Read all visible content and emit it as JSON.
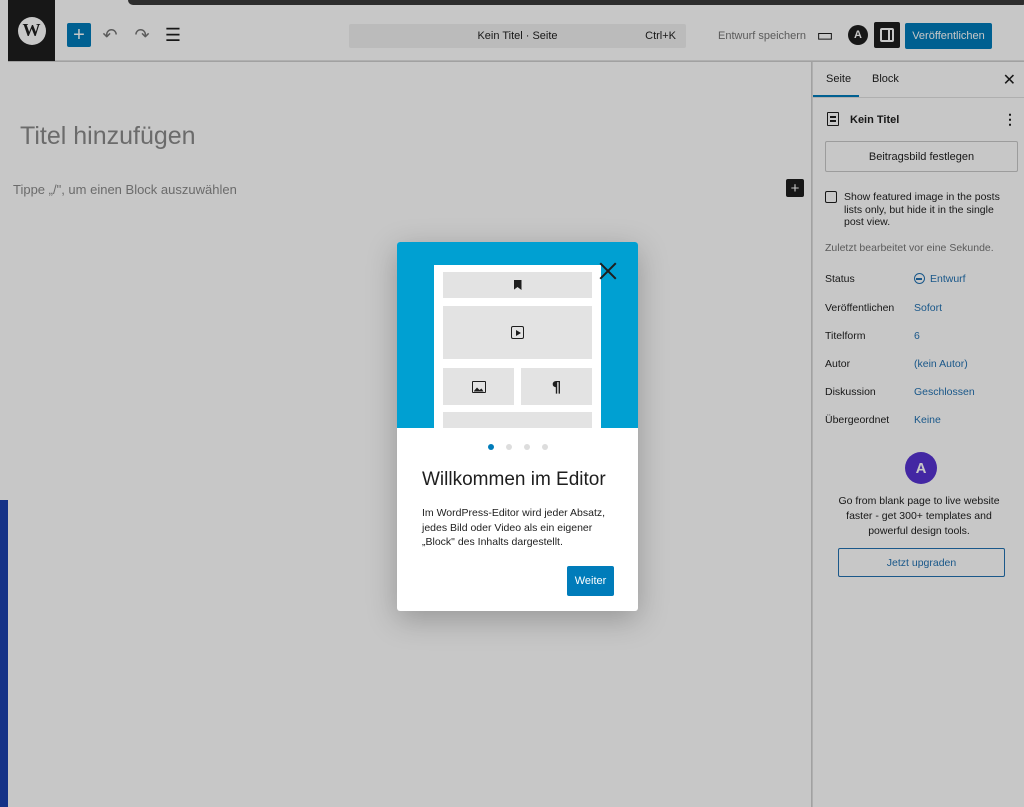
{
  "topbar": {
    "wp_logo": "W",
    "add_icon": "+",
    "undo_icon": "↶",
    "redo_icon": "↷",
    "listview_icon": "☰",
    "document_title": "Kein Titel · Seite",
    "shortcut": "Ctrl+K",
    "save_draft": "Entwurf speichern",
    "preview_icon": "▭",
    "astra_icon": "A",
    "publish": "Veröffentlichen"
  },
  "editor": {
    "title_placeholder": "Titel hinzufügen",
    "block_placeholder": "Tippe „/\", um einen Block auszuwählen",
    "inline_add_icon": "+"
  },
  "sidebar": {
    "tabs": [
      "Seite",
      "Block"
    ],
    "close_icon": "✕",
    "document_name": "Kein Titel",
    "more_icon": "⋮",
    "featured_image_button": "Beitragsbild festlegen",
    "featured_checkbox_label": "Show featured image in the posts lists only, but hide it in the single post view.",
    "last_edited": "Zuletzt bearbeitet vor eine Sekunde.",
    "meta": [
      {
        "label": "Status",
        "value": "Entwurf"
      },
      {
        "label": "Veröffentlichen",
        "value": "Sofort"
      },
      {
        "label": "Titelform",
        "value": "6"
      },
      {
        "label": "Autor",
        "value": "(kein Autor)"
      },
      {
        "label": "Diskussion",
        "value": "Geschlossen"
      },
      {
        "label": "Übergeordnet",
        "value": "Keine"
      }
    ],
    "promo_icon": "A",
    "promo_text": "Go from blank page to live website faster - get 300+ templates and powerful design tools.",
    "upgrade_button": "Jetzt upgraden"
  },
  "modal": {
    "heading": "Willkommen im Editor",
    "body": "Im WordPress-Editor wird jeder Absatz, jedes Bild oder Video als ein eigener „Block\" des Inhalts dargestellt.",
    "next_button": "Weiter",
    "pilcrow": "¶",
    "pages": 4,
    "current_page": 1
  },
  "colors": {
    "accent": "#007cba",
    "hero": "#00a0d2",
    "link": "#2271b1",
    "astra": "#5733d1"
  }
}
